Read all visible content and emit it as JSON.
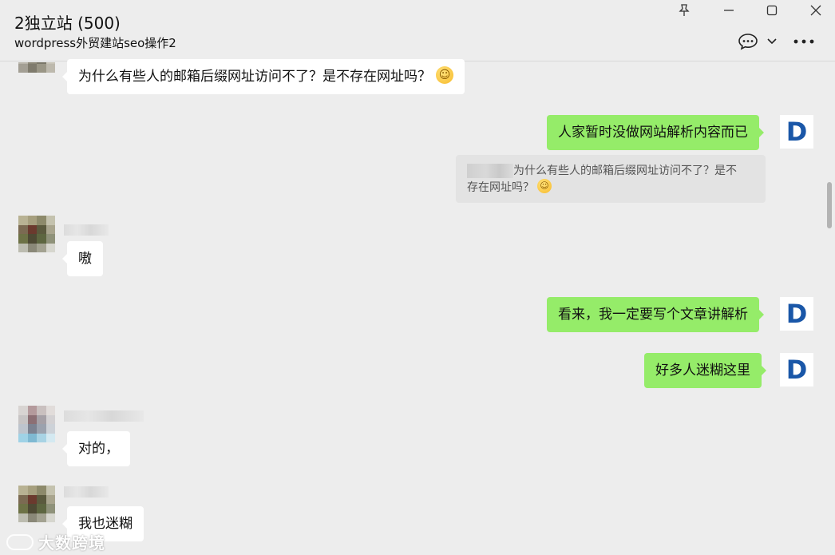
{
  "header": {
    "title": "2独立站 (500)",
    "subtitle": "wordpress外贸建站seo操作2"
  },
  "window_controls": {
    "pin_icon": "pin-icon",
    "minimize_icon": "minimize-icon",
    "maximize_icon": "maximize-icon",
    "close_icon": "close-icon"
  },
  "toolbar": {
    "chat_icon": "chat-bubble-icon",
    "dropdown_icon": "chevron-down-icon",
    "more_icon": "more-icon"
  },
  "messages": [
    {
      "side": "left",
      "text": "为什么有些人的邮箱后缀网址访问不了？是不存在网址吗？",
      "emoji": "☺"
    },
    {
      "side": "right",
      "text": "人家暂时没做网站解析内容而已",
      "avatar_letter": "D"
    },
    {
      "side": "quote",
      "text_line1": "为什么有些人的邮箱后缀网址访问不了？是不",
      "text_line2": "存在网址吗？",
      "emoji": "☺"
    },
    {
      "side": "left",
      "text": "嗷"
    },
    {
      "side": "right",
      "text": "看来，我一定要写个文章讲解析",
      "avatar_letter": "D"
    },
    {
      "side": "right",
      "text": "好多人迷糊这里",
      "avatar_letter": "D"
    },
    {
      "side": "left",
      "text": "对的，"
    },
    {
      "side": "left",
      "text": "我也迷糊"
    }
  ],
  "watermark": {
    "text": "大数跨境"
  },
  "colors": {
    "background": "#ededed",
    "bubble_self": "#95ec69",
    "bubble_other": "#ffffff",
    "avatar_letter": "#1a57a8"
  }
}
